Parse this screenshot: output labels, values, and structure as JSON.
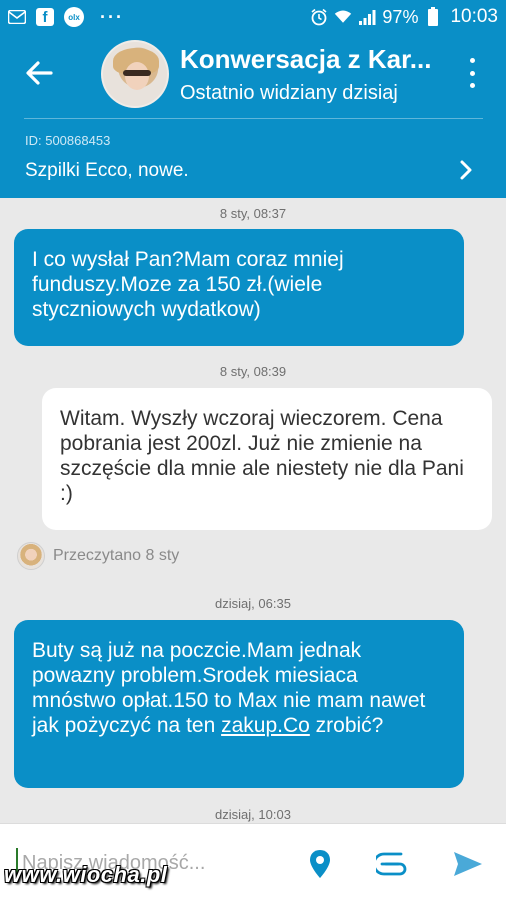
{
  "status_bar": {
    "battery": "97%",
    "time": "10:03",
    "olx_label": "olx",
    "icons": [
      "gmail-icon",
      "facebook-icon",
      "olx-icon",
      "more-dots-icon",
      "alarm-icon",
      "wifi-icon",
      "signal-icon",
      "battery-icon"
    ]
  },
  "header": {
    "title": "Konwersacja z Kar...",
    "subtitle": "Ostatnio widziany dzisiaj",
    "ad_id": "ID: 500868453",
    "ad_title": "Szpilki Ecco, nowe."
  },
  "messages": [
    {
      "timestamp": "8 sty, 08:37",
      "direction": "out",
      "text": "I co wysłał Pan?Mam coraz mniej funduszy.Moze za 150 zł.(wiele styczniowych wydatkow)"
    },
    {
      "timestamp": "8 sty, 08:39",
      "direction": "in",
      "text": "Witam. Wyszły wczoraj wieczorem. Cena pobrania jest 200zl. Już nie zmienie na szczęście dla mnie ale niestety nie dla Pani :)"
    },
    {
      "timestamp": "dzisiaj, 06:35",
      "direction": "out",
      "text_before_link": "Buty są już na poczcie.Mam jednak powazny problem.Srodek miesiaca mnóstwo opłat.150 to Max nie mam nawet jak pożyczyć na ten ",
      "link": "zakup.Co",
      "text_after_link": " zrobić?"
    }
  ],
  "read_receipt": "Przeczytano 8 sty",
  "last_timestamp": "dzisiaj, 10:03",
  "input": {
    "placeholder": "Napisz wiadomość..."
  },
  "watermark": "www.wiocha.pl",
  "colors": {
    "primary": "#0a8fc7",
    "background": "#e9e9e9",
    "incoming_bubble": "#ffffff"
  }
}
